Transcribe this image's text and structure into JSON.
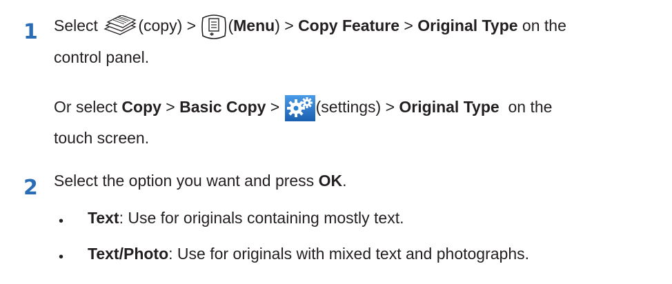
{
  "step1": {
    "number": "1",
    "line1": {
      "pre": "Select ",
      "copy_paren": "(copy) > ",
      "paren_open": "(",
      "menu": "Menu",
      "paren_close": ") > ",
      "copy_feature": "Copy Feature",
      "gt": " > ",
      "original_type": "Original Type",
      "post": " on the"
    },
    "line2": "control panel.",
    "alt_line1": {
      "pre": "Or select ",
      "copy": "Copy",
      "gt1": " > ",
      "basic_copy": "Basic Copy",
      "gt2": " > ",
      "settings_paren": "(settings) > ",
      "original_type": "Original Type",
      "post": "  on the"
    },
    "alt_line2": "touch screen.",
    "icons": [
      "copy-icon",
      "menu-icon",
      "settings-icon"
    ]
  },
  "step2": {
    "number": "2",
    "line": {
      "pre": "Select the option you want and press ",
      "ok": "OK",
      "post": "."
    },
    "bullets": [
      {
        "marker": "•",
        "term": "Text",
        "desc": ": Use for originals containing mostly text."
      },
      {
        "marker": "•",
        "term": "Text/Photo",
        "desc": ": Use for originals with mixed text and photographs."
      }
    ]
  },
  "colors": {
    "step_number": "#2a6db5",
    "text": "#231f20",
    "settings_icon_bg": "#2b7fd3"
  }
}
